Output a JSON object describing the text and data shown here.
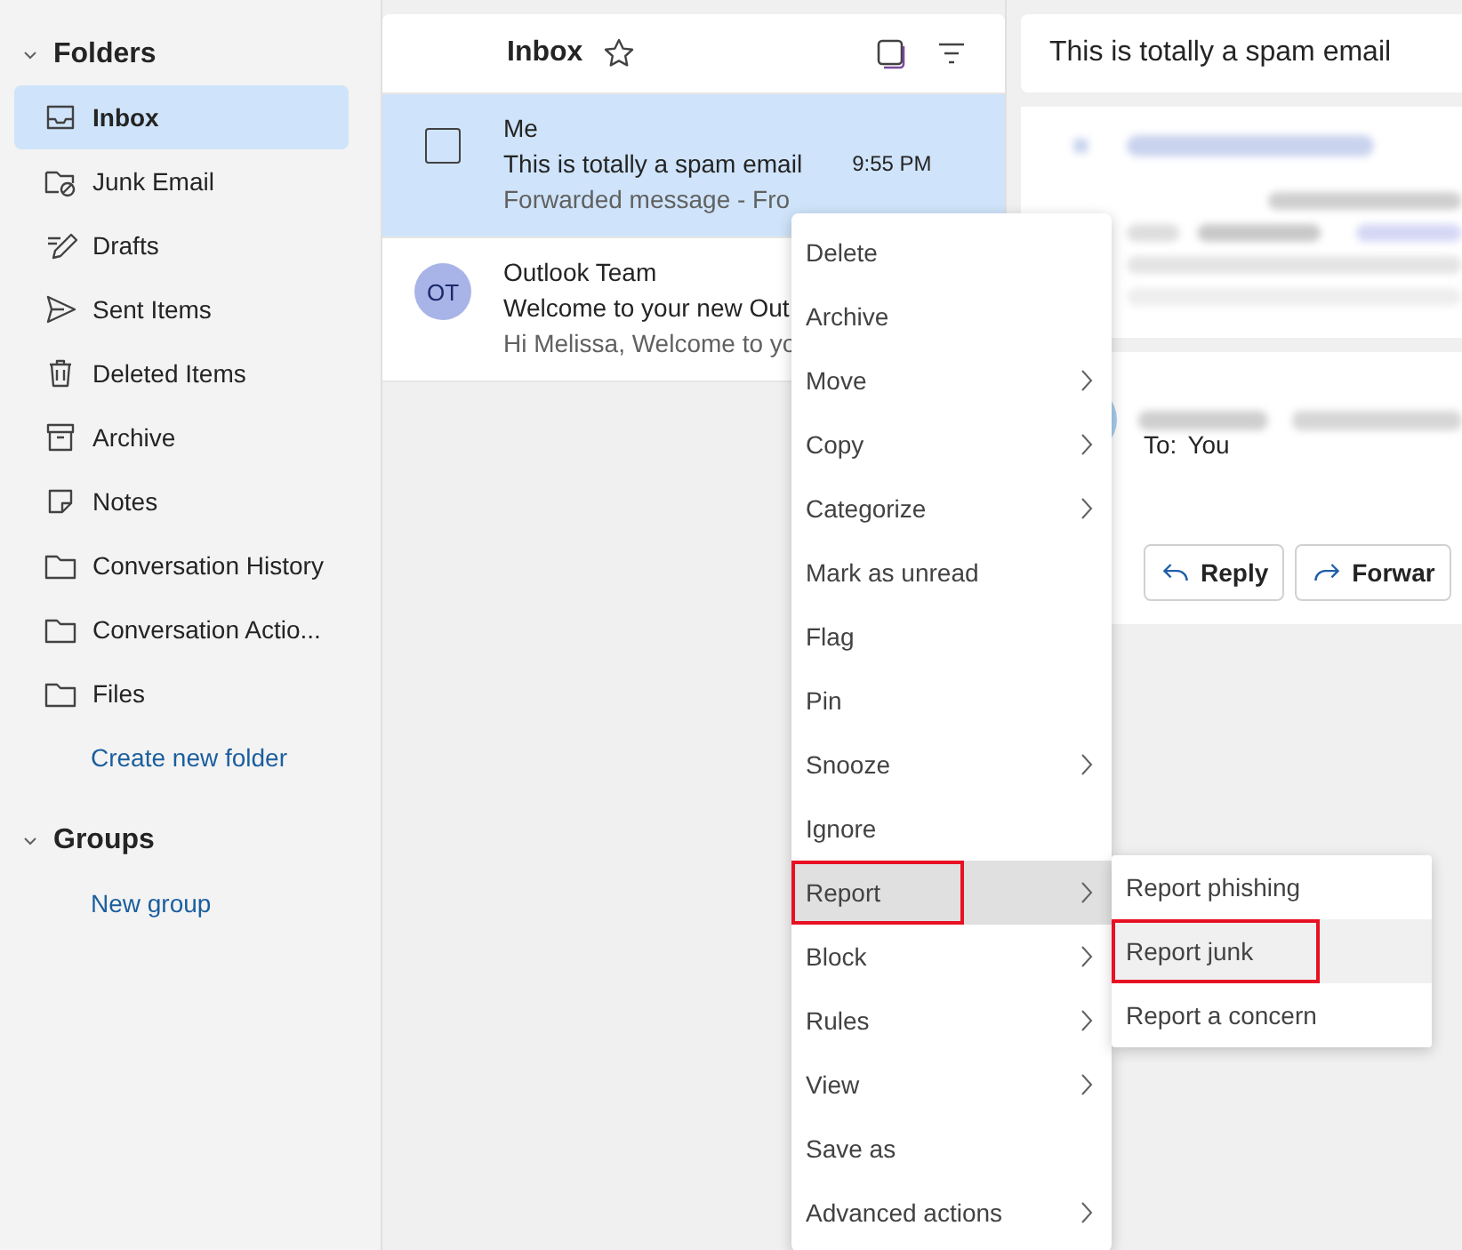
{
  "sidebar": {
    "sections": [
      {
        "title": "Folders",
        "expanded": true,
        "items": [
          {
            "label": "Inbox",
            "selected": true
          },
          {
            "label": "Junk Email",
            "selected": false
          },
          {
            "label": "Drafts",
            "selected": false
          },
          {
            "label": "Sent Items",
            "selected": false
          },
          {
            "label": "Deleted Items",
            "selected": false
          },
          {
            "label": "Archive",
            "selected": false
          },
          {
            "label": "Notes",
            "selected": false
          },
          {
            "label": "Conversation History",
            "selected": false
          },
          {
            "label": "Conversation Actio...",
            "selected": false
          },
          {
            "label": "Files",
            "selected": false
          }
        ],
        "link": "Create new folder"
      },
      {
        "title": "Groups",
        "expanded": true,
        "link": "New group"
      }
    ]
  },
  "message_list": {
    "title": "Inbox",
    "messages": [
      {
        "sender": "Me",
        "subject": "This is totally a spam email",
        "time": "9:55 PM",
        "preview": "Forwarded message - Fro",
        "selected": true
      },
      {
        "sender": "Outlook Team",
        "subject": "Welcome to your new Out",
        "preview": "Hi Melissa, Welcome to yo",
        "selected": false,
        "avatar": "OT"
      }
    ]
  },
  "reading_pane": {
    "subject": "This is totally a spam email",
    "to_label": "To:",
    "to_value": "You",
    "buttons": [
      "Reply",
      "Forwar"
    ]
  },
  "context_menu": {
    "items": [
      {
        "label": "Delete",
        "submenu": false,
        "selected": false,
        "annotated": false
      },
      {
        "label": "Archive",
        "submenu": false,
        "selected": false,
        "annotated": false
      },
      {
        "label": "Move",
        "submenu": true,
        "selected": false,
        "annotated": false
      },
      {
        "label": "Copy",
        "submenu": true,
        "selected": false,
        "annotated": false
      },
      {
        "label": "Categorize",
        "submenu": true,
        "selected": false,
        "annotated": false
      },
      {
        "label": "Mark as unread",
        "submenu": false,
        "selected": false,
        "annotated": false
      },
      {
        "label": "Flag",
        "submenu": false,
        "selected": false,
        "annotated": false
      },
      {
        "label": "Pin",
        "submenu": false,
        "selected": false,
        "annotated": false
      },
      {
        "label": "Snooze",
        "submenu": true,
        "selected": false,
        "annotated": false
      },
      {
        "label": "Ignore",
        "submenu": false,
        "selected": false,
        "annotated": false
      },
      {
        "label": "Report",
        "submenu": true,
        "selected": true,
        "annotated": true
      },
      {
        "label": "Block",
        "submenu": true,
        "selected": false,
        "annotated": false
      },
      {
        "label": "Rules",
        "submenu": true,
        "selected": false,
        "annotated": false
      },
      {
        "label": "View",
        "submenu": true,
        "selected": false,
        "annotated": false
      },
      {
        "label": "Save as",
        "submenu": false,
        "selected": false,
        "annotated": false
      },
      {
        "label": "Advanced actions",
        "submenu": true,
        "selected": false,
        "annotated": false
      }
    ]
  },
  "submenu": {
    "items": [
      {
        "label": "Report phishing",
        "selected": false,
        "annotated": false
      },
      {
        "label": "Report junk",
        "selected": true,
        "annotated": true
      },
      {
        "label": "Report a concern",
        "selected": false,
        "annotated": false
      }
    ]
  }
}
